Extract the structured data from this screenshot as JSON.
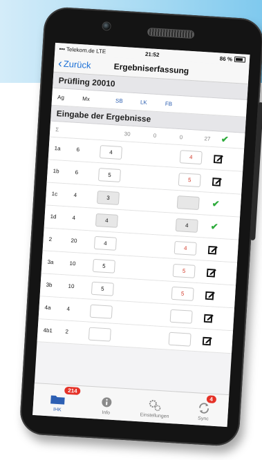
{
  "status_bar": {
    "carrier": "Telekom.de",
    "network": "LTE",
    "time": "21:52",
    "battery": "86 %"
  },
  "nav": {
    "back_label": "Zurück",
    "title": "Ergebniserfassung"
  },
  "pruefling": {
    "label": "Prüfling 20010"
  },
  "columns": {
    "ag": "Ag",
    "mx": "Mx",
    "sb": "SB",
    "lk": "LK",
    "fb": "FB"
  },
  "eingabe": {
    "label": "Eingabe der Ergebnisse"
  },
  "sum": {
    "symbol": "Σ",
    "v1": "30",
    "v2": "0",
    "v3": "0",
    "v4": "27"
  },
  "rows": [
    {
      "label": "1a",
      "mx": "6",
      "sb": "4",
      "lk": "4"
    },
    {
      "label": "1b",
      "mx": "6",
      "sb": "5",
      "lk": "5"
    },
    {
      "label": "1c",
      "mx": "4",
      "sb": "3",
      "lk": ""
    },
    {
      "label": "1d",
      "mx": "4",
      "sb": "4",
      "lk": "4"
    },
    {
      "label": "2",
      "mx": "20",
      "sb": "4",
      "lk": "4"
    },
    {
      "label": "3a",
      "mx": "10",
      "sb": "5",
      "lk": "5"
    },
    {
      "label": "3b",
      "mx": "10",
      "sb": "5",
      "lk": "5"
    },
    {
      "label": "4a",
      "mx": "4",
      "sb": "",
      "lk": ""
    },
    {
      "label": "4b1",
      "mx": "2",
      "sb": "",
      "lk": ""
    }
  ],
  "tabs": {
    "ihk": "IHK",
    "ihk_badge": "214",
    "info": "Info",
    "einstellungen": "Einstellungen",
    "sync": "Sync",
    "sync_badge": "4"
  },
  "colors": {
    "accent": "#1a6fd6",
    "check": "#2eab3c",
    "error": "#d23a2a",
    "badge": "#e53228"
  },
  "icons": {
    "edit": "edit-icon",
    "check": "checkmark-icon"
  }
}
